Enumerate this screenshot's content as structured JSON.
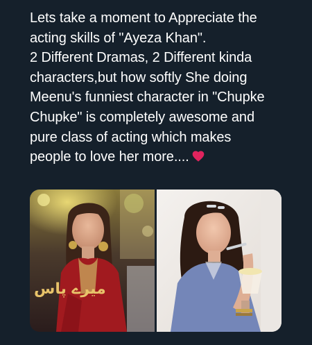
{
  "tweet": {
    "text_lines": [
      "Lets take a moment to Appreciate the",
      "acting skills of \"Ayeza Khan\".",
      "2 Different Dramas, 2 Different kinda",
      "characters,but how softly She doing",
      "Meenu's funniest character in \"Chupke",
      "Chupke\" is completely awesome and",
      "pure class of acting which makes",
      "people to love her more...."
    ],
    "emoji": "red-heart-icon"
  },
  "media": {
    "images": [
      {
        "name": "photo-red-dress-drama-scene",
        "logo_text": "میرے پاس"
      },
      {
        "name": "photo-blue-shirt-eating-dessert"
      }
    ]
  },
  "colors": {
    "background": "#15202b",
    "text": "#ffffff",
    "heart": "#e0245e"
  }
}
